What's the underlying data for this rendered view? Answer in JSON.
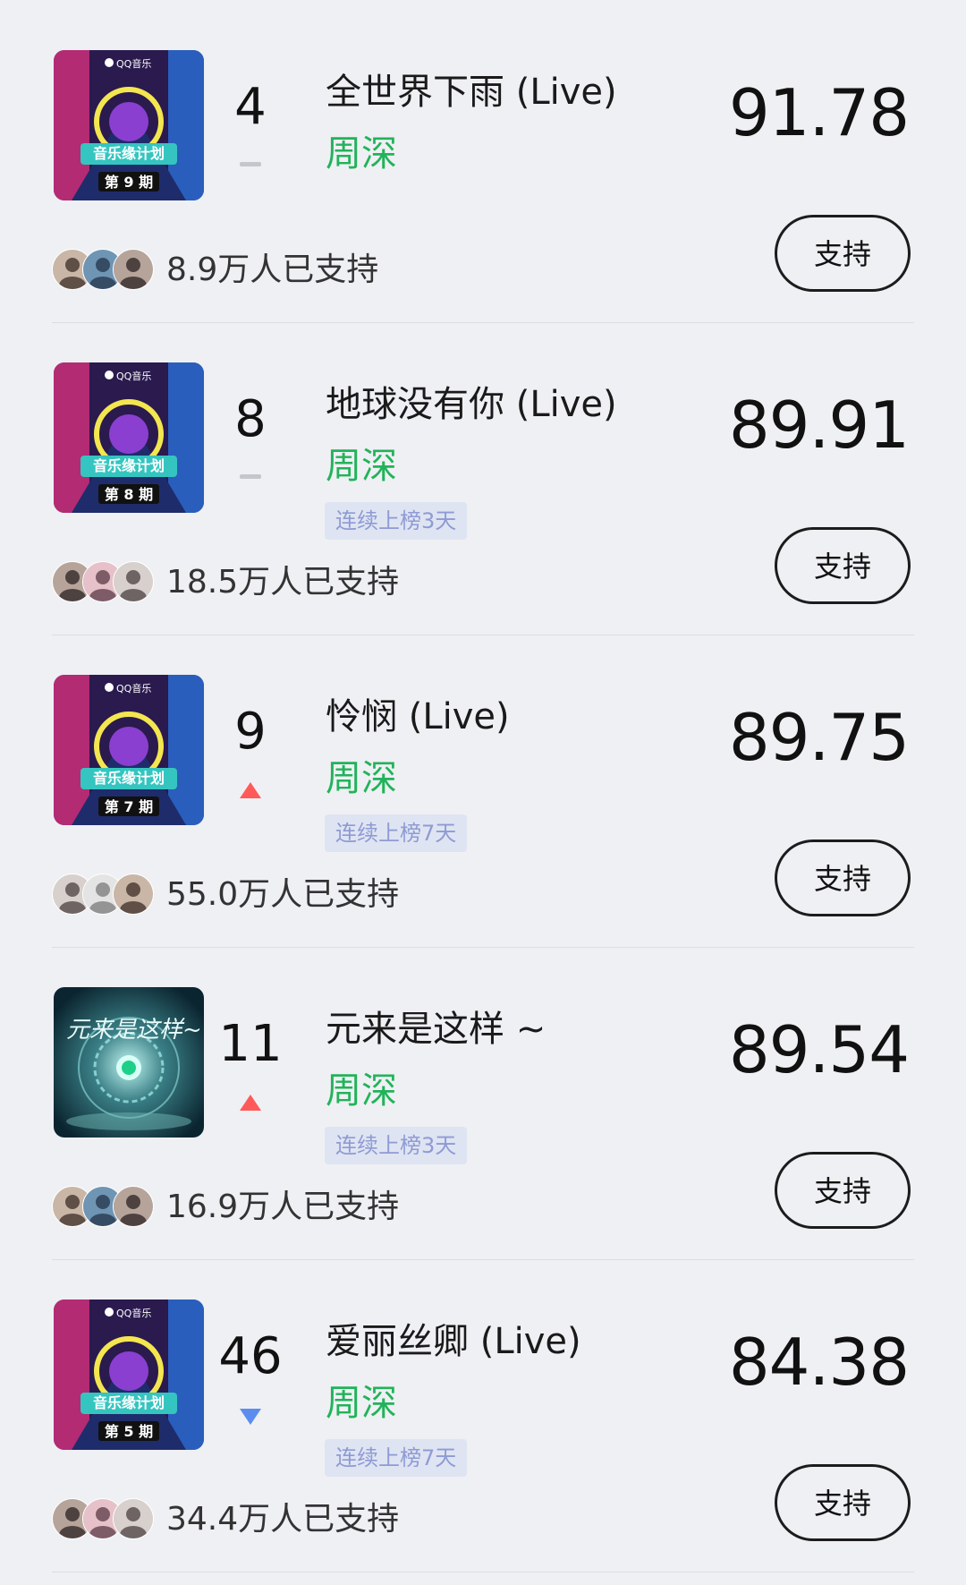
{
  "colors": {
    "background": "#eff0f4",
    "artist": "#22b35a",
    "streak_bg": "#dfe4f2",
    "streak_text": "#8e9bd4",
    "trend_up": "#ff5a5a",
    "trend_down": "#5b8def",
    "trend_flat": "#c4c6cc"
  },
  "entries": [
    {
      "rank": "4",
      "trend": "flat",
      "title": "全世界下雨 (Live)",
      "artist": "周深",
      "streak": "",
      "score": "91.78",
      "supporters": "8.9万人已支持",
      "button_label": "支持",
      "cover": {
        "style": "show",
        "brand": "QQ音乐",
        "show_title": "音乐缘计划",
        "episode": "第 9 期"
      }
    },
    {
      "rank": "8",
      "trend": "flat",
      "title": "地球没有你 (Live)",
      "artist": "周深",
      "streak": "连续上榜3天",
      "score": "89.91",
      "supporters": "18.5万人已支持",
      "button_label": "支持",
      "cover": {
        "style": "show",
        "brand": "QQ音乐",
        "show_title": "音乐缘计划",
        "episode": "第 8 期"
      }
    },
    {
      "rank": "9",
      "trend": "up",
      "title": "怜悯 (Live)",
      "artist": "周深",
      "streak": "连续上榜7天",
      "score": "89.75",
      "supporters": "55.0万人已支持",
      "button_label": "支持",
      "cover": {
        "style": "show",
        "brand": "QQ音乐",
        "show_title": "音乐缘计划",
        "episode": "第 7 期"
      }
    },
    {
      "rank": "11",
      "trend": "up",
      "title": "元来是这样 ~",
      "artist": "周深",
      "streak": "连续上榜3天",
      "score": "89.54",
      "supporters": "16.9万人已支持",
      "button_label": "支持",
      "cover": {
        "style": "scifi",
        "brand": "",
        "show_title": "元来是这样~",
        "episode": ""
      }
    },
    {
      "rank": "46",
      "trend": "down",
      "title": "爱丽丝卿 (Live)",
      "artist": "周深",
      "streak": "连续上榜7天",
      "score": "84.38",
      "supporters": "34.4万人已支持",
      "button_label": "支持",
      "cover": {
        "style": "show",
        "brand": "QQ音乐",
        "show_title": "音乐缘计划",
        "episode": "第 5 期"
      }
    }
  ]
}
